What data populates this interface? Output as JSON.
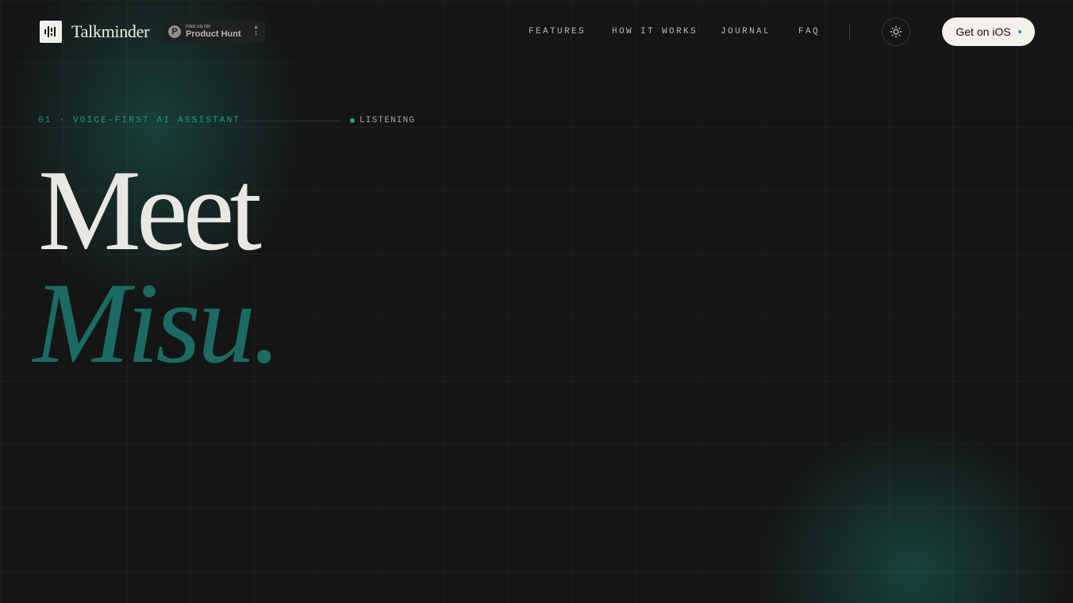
{
  "header": {
    "brand": "Talkminder",
    "product_hunt": {
      "small": "FIND US ON",
      "big": "Product Hunt",
      "vote_count": "1",
      "vote_arrow": "▲"
    },
    "nav": [
      {
        "label": "FEATURES"
      },
      {
        "label": "HOW IT WORKS"
      },
      {
        "label": "JOURNAL"
      },
      {
        "label": "FAQ"
      }
    ],
    "cta_label": "Get on iOS"
  },
  "hero": {
    "eyebrow": "01 · VOICE-FIRST AI ASSISTANT",
    "status": "LISTENING",
    "headline_line1": "Meet",
    "headline_line2": "Misu."
  },
  "icons": {
    "logo": "waveform-logo-icon",
    "theme": "sun-icon",
    "product_hunt": "product-hunt-icon"
  },
  "colors": {
    "accent": "#1aa394",
    "accent_dark": "#1b6a63",
    "background": "#141515",
    "cta_bg": "#f3f1ea"
  }
}
